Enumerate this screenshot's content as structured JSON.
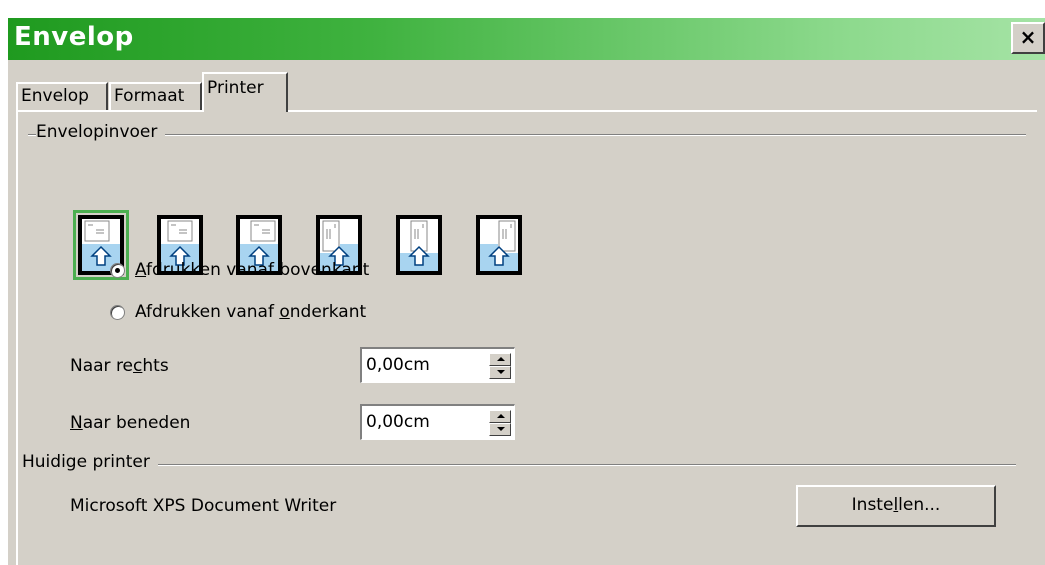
{
  "window": {
    "title": "Envelop",
    "close_label": "×",
    "colors": {
      "titlebar_start": "#1f9a1f",
      "titlebar_end": "#a5e3a5",
      "dialog_bg": "#d4d0c8",
      "selected_outline": "#4caf50",
      "arrow_blue": "#1e90ff"
    }
  },
  "tabs": [
    {
      "label": "Envelop",
      "active": false
    },
    {
      "label": "Formaat",
      "active": false
    },
    {
      "label": "Printer",
      "active": true
    }
  ],
  "envelope_feed": {
    "group_label": "Envelopinvoer",
    "options": [
      {
        "icon": "envelope-feed-horizontal-left-icon",
        "selected": true
      },
      {
        "icon": "envelope-feed-horizontal-center-icon",
        "selected": false
      },
      {
        "icon": "envelope-feed-horizontal-right-icon",
        "selected": false
      },
      {
        "icon": "envelope-feed-vertical-left-icon",
        "selected": false
      },
      {
        "icon": "envelope-feed-vertical-center-icon",
        "selected": false
      },
      {
        "icon": "envelope-feed-vertical-right-icon",
        "selected": false
      }
    ],
    "radio_top": {
      "prefix": "",
      "mnemonic": "A",
      "rest": "fdrukken vanaf bovenkant",
      "checked": true
    },
    "radio_bottom": {
      "prefix": "Afdrukken vanaf ",
      "mnemonic": "o",
      "rest": "nderkant",
      "checked": false
    }
  },
  "offsets": {
    "right": {
      "prefix": "Naar re",
      "mnemonic": "c",
      "rest": "hts",
      "value": "0,00cm"
    },
    "down": {
      "prefix": "",
      "mnemonic": "N",
      "rest": "aar beneden",
      "value": "0,00cm"
    }
  },
  "current_printer": {
    "group_label": "Huidige printer",
    "name": "Microsoft XPS Document Writer",
    "setup_button": {
      "prefix": "Inste",
      "mnemonic": "l",
      "rest": "len..."
    }
  }
}
